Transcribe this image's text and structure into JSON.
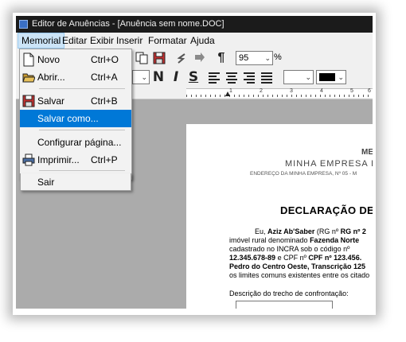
{
  "window": {
    "title": "Editor de Anuências - [Anuência sem nome.DOC]"
  },
  "menubar": {
    "items": [
      {
        "label": "Memorial",
        "active": true
      },
      {
        "label": "Editar"
      },
      {
        "label": "Exibir"
      },
      {
        "label": "Inserir"
      },
      {
        "label": "Formatar"
      },
      {
        "label": "Ajuda"
      }
    ]
  },
  "toolbar": {
    "zoom_value": "95",
    "zoom_unit": "%",
    "font_size_value": "",
    "bold_label": "N",
    "italic_label": "I",
    "underline_label": "S",
    "paragraph_label": "¶",
    "text_color": "#000000",
    "accent_color": "#0078d7"
  },
  "ruler": {
    "numbers": [
      "1",
      "2",
      "3",
      "4",
      "5",
      "6"
    ]
  },
  "memorial_menu": {
    "items": [
      {
        "label": "Novo",
        "shortcut": "Ctrl+O",
        "icon": "new-document-icon"
      },
      {
        "label": "Abrir...",
        "shortcut": "Ctrl+A",
        "icon": "open-folder-icon"
      },
      {
        "label": "Salvar",
        "shortcut": "Ctrl+B",
        "icon": "floppy-disk-icon"
      },
      {
        "label": "Salvar como...",
        "shortcut": "",
        "highlighted": true
      },
      {
        "label": "Configurar página...",
        "shortcut": ""
      },
      {
        "label": "Imprimir...",
        "shortcut": "Ctrl+P",
        "icon": "printer-icon"
      },
      {
        "label": "Sair",
        "shortcut": ""
      }
    ]
  },
  "document": {
    "header_partial": "ME",
    "company_name": "MINHA EMPRESA EN",
    "company_address": "ENDEREÇO DA MINHA EMPRESA, Nº 05 - M",
    "heading": "DECLARAÇÃO DE",
    "body": {
      "l1_intro": "Eu, ",
      "l1_name": "Aziz Ab'Saber",
      "l1_mid": " (RG nº ",
      "l1_rg": "RG nº 2",
      "l2_pre": "imóvel rural denominado ",
      "l2_farm": "Fazenda Norte",
      "l3": "cadastrado no INCRA sob o código nº",
      "l4_cpf1": "12.345.678-89",
      "l4_mid": " e CPF nº ",
      "l4_cpf2": "CPF nº 123.456.",
      "l5": "Pedro do Centro Oeste, Transcrição 125",
      "l6": "os limites comuns existentes entre os citado"
    },
    "confrontacao_label": "Descrição do trecho de confrontação:"
  }
}
